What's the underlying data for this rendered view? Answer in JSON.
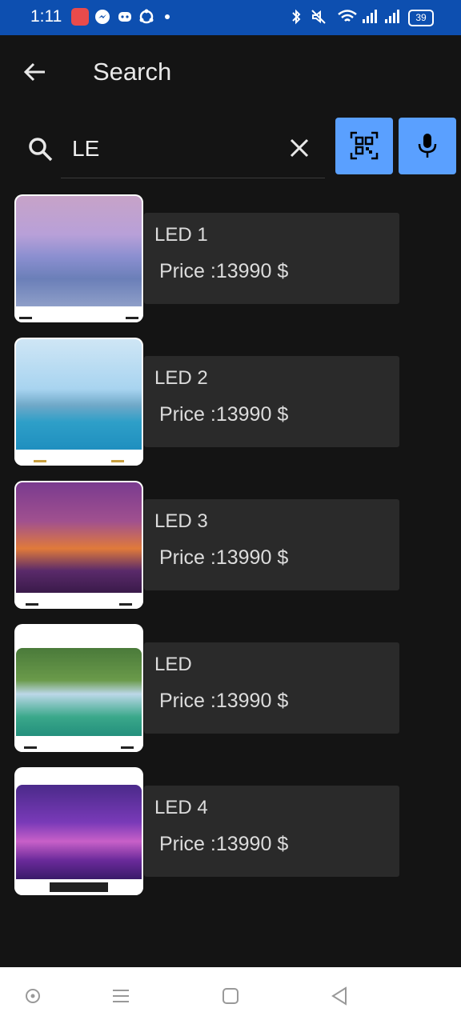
{
  "status_bar": {
    "time": "1:11",
    "battery": "39"
  },
  "header": {
    "title": "Search"
  },
  "search": {
    "value": "LE",
    "placeholder": ""
  },
  "results": [
    {
      "name": "LED 1",
      "price": "Price :13990 $"
    },
    {
      "name": "LED 2",
      "price": "Price :13990 $"
    },
    {
      "name": "LED 3",
      "price": "Price :13990 $"
    },
    {
      "name": "LED",
      "price": "Price :13990 $"
    },
    {
      "name": "LED 4",
      "price": "Price :13990 $"
    }
  ],
  "colors": {
    "status_bar": "#0d4fb0",
    "background": "#141414",
    "accent_button": "#5aa0ff",
    "card": "#2a2a2a"
  },
  "icons": [
    "back-arrow-icon",
    "search-icon",
    "clear-icon",
    "qr-scan-icon",
    "microphone-icon",
    "home-nav-icon",
    "menu-nav-icon",
    "square-nav-icon",
    "back-nav-icon"
  ]
}
